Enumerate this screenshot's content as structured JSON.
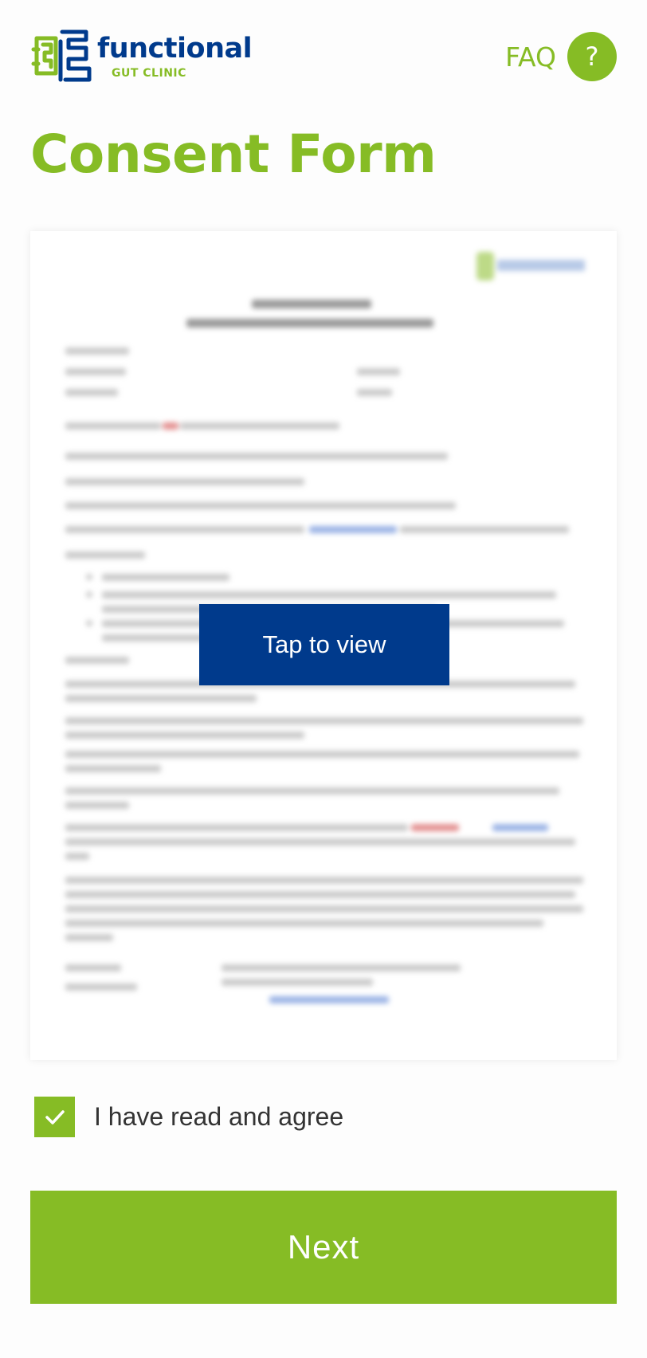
{
  "brand": {
    "name": "functional",
    "subname": "GUT CLINIC",
    "primary_color": "#86bc25",
    "secondary_color": "#003a8c",
    "logo_icon": "gut-maze-logo-icon"
  },
  "header": {
    "faq_label": "FAQ",
    "faq_icon_glyph": "?",
    "faq_icon": "question-circle-icon"
  },
  "page": {
    "title": "Consent Form"
  },
  "document_preview": {
    "tap_label": "Tap to view"
  },
  "agreement": {
    "label": "I have read and agree",
    "checked": true,
    "check_icon": "checkmark-icon"
  },
  "actions": {
    "next_label": "Next"
  }
}
